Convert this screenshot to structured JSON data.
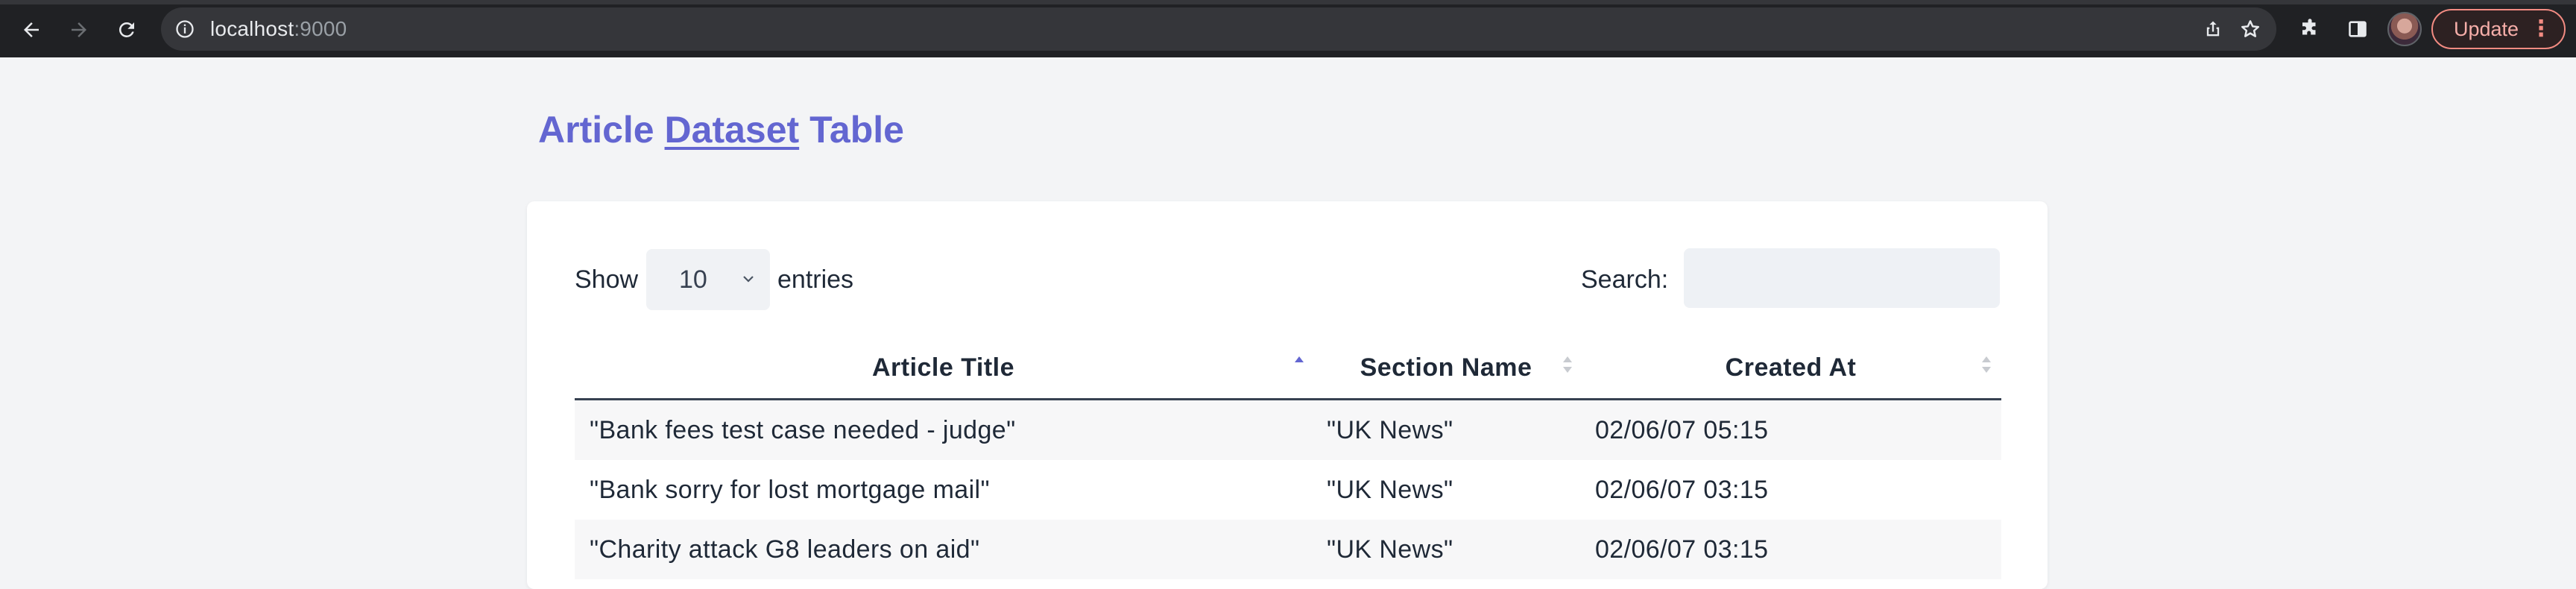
{
  "browser": {
    "url_host": "localhost",
    "url_port": ":9000",
    "update_label": "Update",
    "icons": [
      "back-icon",
      "forward-icon",
      "reload-icon",
      "info-icon",
      "share-icon",
      "bookmark-star-icon",
      "extensions-icon",
      "side-panel-icon",
      "avatar",
      "more-menu-icon"
    ]
  },
  "page": {
    "title_word1": "Article",
    "title_link": "Dataset",
    "title_word3": "Table",
    "accent_color": "#6366d1"
  },
  "controls": {
    "show_label": "Show",
    "entries_value": "10",
    "entries_label": "entries",
    "search_label": "Search:",
    "search_value": ""
  },
  "table": {
    "columns": [
      {
        "label": "Article Title",
        "sort": "ascending"
      },
      {
        "label": "Section Name",
        "sort": "none"
      },
      {
        "label": "Created At",
        "sort": "none"
      }
    ],
    "rows": [
      {
        "title": "\"Bank fees test case needed - judge\"",
        "section": "\"UK News\"",
        "created": "02/06/07 05:15"
      },
      {
        "title": "\"Bank sorry for lost mortgage mail\"",
        "section": "\"UK News\"",
        "created": "02/06/07 03:15"
      },
      {
        "title": "\"Charity attack G8 leaders on aid\"",
        "section": "\"UK News\"",
        "created": "02/06/07 03:15"
      }
    ]
  }
}
